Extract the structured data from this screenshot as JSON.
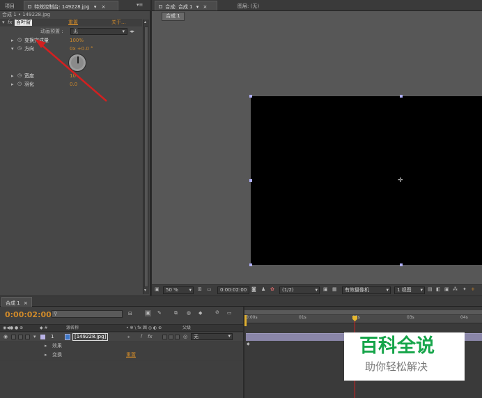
{
  "effect_panel": {
    "tabs": [
      "项目",
      "特效控制台: 149228.jpg"
    ],
    "subheader": "合成 1 • 149228.jpg",
    "effect_name": "百叶窗",
    "reset": "重置",
    "about": "关于...",
    "anim_preset_label": "动画预置 :",
    "anim_preset_value": "无",
    "props": [
      {
        "name": "变换完成量",
        "value": "100%"
      },
      {
        "name": "方向",
        "value": "0x +0.0 °"
      },
      {
        "name": "宽度",
        "value": "10"
      },
      {
        "name": "羽化",
        "value": "0.0"
      }
    ]
  },
  "comp_panel": {
    "tabs": [
      "合成: 合成 1",
      "图层: (无)"
    ],
    "sub_tab": "合成 1",
    "bottom_bar": {
      "zoom": "50 %",
      "timecode": "0:00:02:00",
      "resolution": "(1/2)",
      "camera": "有效摄像机",
      "view": "1 视图"
    }
  },
  "timeline": {
    "tab": "合成 1",
    "timecode": "0:00:02:00",
    "search_placeholder": "",
    "col_source": "源名称",
    "col_switches": "• ✻ \\ fx 囲 ◎ ◐ ⊕",
    "col_parent": "父级",
    "ruler": [
      "0:00s",
      "01s",
      "02s",
      "03s",
      "04s"
    ],
    "layer": {
      "num": "1",
      "name": "[149228.jpg]",
      "parent": "无"
    },
    "sub_rows": [
      {
        "label": "效果",
        "value": ""
      },
      {
        "label": "变换",
        "value": "重置"
      }
    ]
  },
  "watermark": {
    "title": "百科全说",
    "subtitle": "助你轻松解决"
  },
  "colors": {
    "accent_orange": "#d08a2a",
    "arrow_red": "#d32020",
    "panel": "#474747",
    "viewer_bg": "#575757",
    "playhead": "#d61f1f",
    "watermark_green": "#16a54a"
  }
}
